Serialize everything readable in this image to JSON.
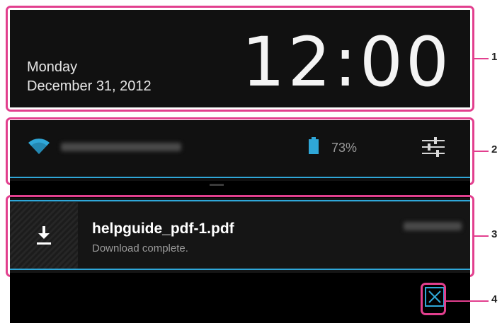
{
  "clock": {
    "day": "Monday",
    "date": "December 31, 2012",
    "time": "12:00"
  },
  "status_bar": {
    "wifi_icon": "wifi-icon",
    "battery_icon": "battery-icon",
    "battery_percent": "73%",
    "settings_icon": "quick-settings-icon"
  },
  "notification": {
    "icon": "download-icon",
    "title": "helpguide_pdf-1.pdf",
    "subtitle": "Download complete."
  },
  "clear_button": {
    "icon": "clear-all-icon"
  },
  "callouts": [
    "1",
    "2",
    "3",
    "4"
  ],
  "colors": {
    "accent": "#2fa7d8",
    "callout": "#e23f8e",
    "panel": "#111111"
  }
}
